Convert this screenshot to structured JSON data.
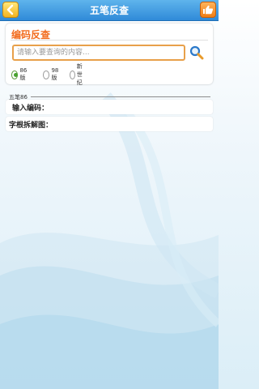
{
  "header": {
    "title": "五笔反查"
  },
  "search": {
    "heading": "编码反查",
    "placeholder": "请输入要查询的内容..."
  },
  "versions": [
    {
      "label": "86版",
      "selected": true
    },
    {
      "label": "98版",
      "selected": false
    },
    {
      "label": "新世纪",
      "selected": false
    }
  ],
  "result": {
    "section_label": "五笔86",
    "input_code_label": "输入编码：",
    "decomposition_label": "字根拆解图："
  },
  "colors": {
    "titlebar": "#3a95de",
    "heading": "#f26c1e",
    "input_border": "#e8a04a",
    "radio_checked": "#47a22f"
  },
  "icons": [
    "back-icon",
    "thumbs-up-icon",
    "search-icon"
  ]
}
